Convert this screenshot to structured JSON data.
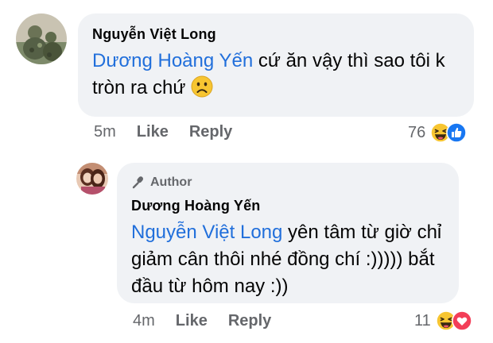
{
  "comment1": {
    "author": "Nguyễn Việt Long",
    "mention": "Dương Hoàng Yến",
    "text": " cứ ăn vậy thì sao tôi k tròn ra chứ ",
    "time": "5m",
    "like_label": "Like",
    "reply_label": "Reply",
    "reaction_count": "76",
    "reaction_icons": [
      "haha-icon",
      "like-icon"
    ]
  },
  "comment2": {
    "badge": "Author",
    "author": "Dương Hoàng Yến",
    "mention": "Nguyễn Việt Long",
    "text": " yên tâm từ giờ chỉ giảm cân thôi nhé đồng chí :))))) bắt đầu từ hôm nay :))",
    "time": "4m",
    "like_label": "Like",
    "reply_label": "Reply",
    "reaction_count": "11",
    "reaction_icons": [
      "haha-icon",
      "love-icon"
    ]
  },
  "colors": {
    "bubble": "#f0f2f5",
    "mention": "#216fdb",
    "meta": "#65676b",
    "like_blue": "#1877f2",
    "love_red": "#f33e58",
    "emoji_yellow": "#f7c531"
  }
}
